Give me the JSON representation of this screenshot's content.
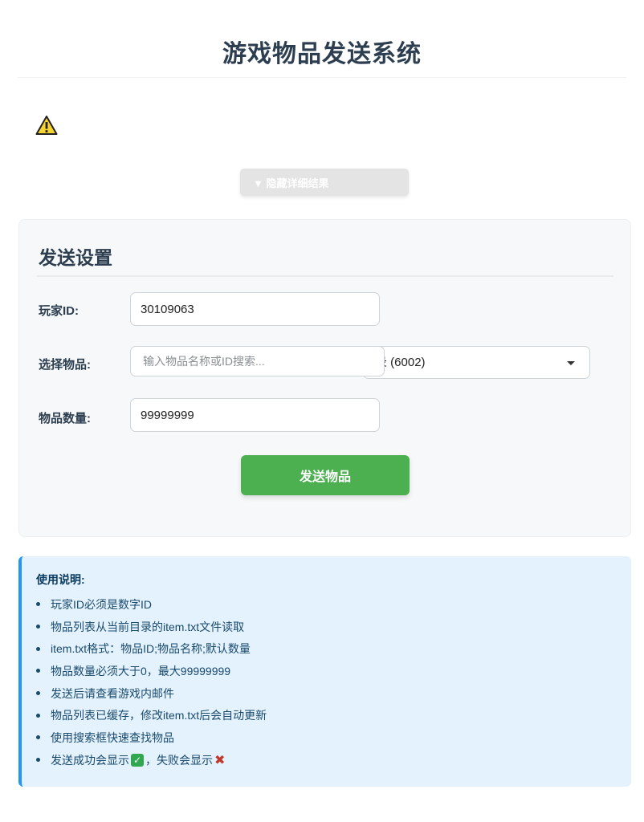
{
  "header": {
    "title": "游戏物品发送系统"
  },
  "result": {
    "warning_icon": "warning-triangle-icon",
    "toggle_label": "▼ 隐藏详细结果"
  },
  "settings": {
    "title": "发送设置",
    "player_id": {
      "label": "玩家ID:",
      "value": "30109063"
    },
    "item": {
      "label": "选择物品:",
      "search_placeholder": "输入物品名称或ID搜索...",
      "selected_text": "录 (6002)"
    },
    "quantity": {
      "label": "物品数量:",
      "value": "99999999"
    },
    "send_label": "发送物品"
  },
  "help": {
    "title": "使用说明:",
    "items": [
      "玩家ID必须是数字ID",
      "物品列表从当前目录的item.txt文件读取",
      "item.txt格式：物品ID;物品名称;默认数量",
      "物品数量必须大于0，最大99999999",
      "发送后请查看游戏内邮件",
      "物品列表已缓存，修改item.txt后会自动更新",
      "使用搜索框快速查找物品"
    ],
    "last_item_prefix": "发送成功会显示",
    "last_item_middle": "，失败会显示",
    "success_icon": "check-mark-button-icon",
    "failure_icon": "cross-mark-icon"
  },
  "colors": {
    "accent_green": "#4caf50",
    "info_blue": "#2196f3",
    "info_bg": "#e3f2fd",
    "title": "#2c3e50"
  }
}
